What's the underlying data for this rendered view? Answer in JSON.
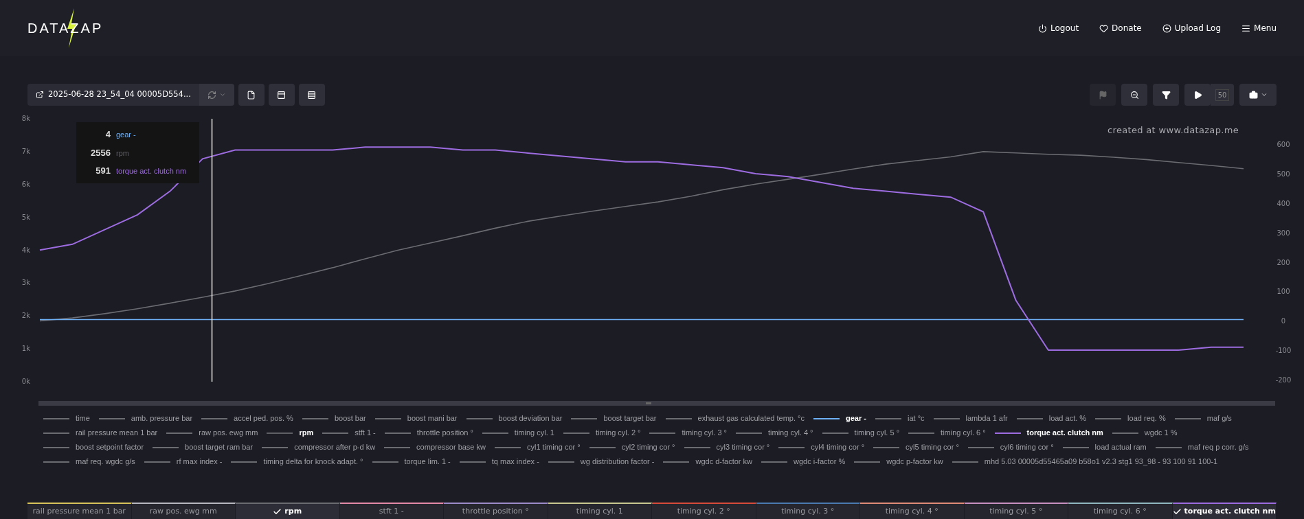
{
  "header": {
    "logo": "DATAZAP",
    "nav": [
      {
        "kind": "power",
        "label": "Logout"
      },
      {
        "kind": "heart",
        "label": "Donate"
      },
      {
        "kind": "plus",
        "label": "Upload Log"
      },
      {
        "kind": "menu",
        "label": "Menu"
      }
    ]
  },
  "toolbar": {
    "file_name": "2025-06-28 23_54_04 00005D554...",
    "left_buttons": [
      {
        "kind": "file"
      },
      {
        "kind": "panel"
      },
      {
        "kind": "rows"
      }
    ],
    "right_buttons": [
      {
        "kind": "flag",
        "disabled": true
      },
      {
        "kind": "zoom",
        "disabled": false
      },
      {
        "kind": "filter",
        "disabled": false
      },
      {
        "kind": "play",
        "disabled": false
      }
    ],
    "speed": "50"
  },
  "chart": {
    "watermark": "created at www.datazap.me",
    "cursor": {
      "level": 0.143
    },
    "tooltip": [
      {
        "value": "4",
        "label": "gear -",
        "color": "#6fb1f7"
      },
      {
        "value": "2556",
        "label": "rpm",
        "color": "#5f5f66"
      },
      {
        "value": "591",
        "label": "torque act. clutch nm",
        "color": "#9d6ce0"
      }
    ],
    "chart_data": {
      "type": "line",
      "yticks": [
        {
          "value": 0,
          "label": "0k"
        },
        {
          "value": 1000,
          "label": "1k"
        },
        {
          "value": 2000,
          "label": "2k"
        },
        {
          "value": 3000,
          "label": "3k"
        },
        {
          "value": 4000,
          "label": "4k"
        },
        {
          "value": 5000,
          "label": "5k"
        },
        {
          "value": 6000,
          "label": "6k"
        },
        {
          "value": 7000,
          "label": "7k"
        },
        {
          "value": 8000,
          "label": "8k"
        }
      ],
      "y2ticks": [
        -200,
        -100,
        0,
        100,
        200,
        300,
        400,
        500,
        600
      ],
      "ylim": [
        0,
        8000
      ],
      "y2lim": [
        -200,
        600
      ],
      "series": [
        {
          "color": "#6b6b72",
          "values": [
            1850,
            1940,
            2070,
            2220,
            2390,
            2570,
            2760,
            2980,
            3220,
            3470,
            3740,
            4000,
            4220,
            4440,
            4670,
            4880,
            5040,
            5190,
            5330,
            5470,
            5640,
            5840,
            6010,
            6160,
            6310,
            6470,
            6620,
            6730,
            6840,
            7000,
            6960,
            6920,
            6890,
            6830,
            6760,
            6670,
            6580,
            6480
          ]
        },
        {
          "axis": "y2",
          "color": "#6fb1f7",
          "values": [
            4,
            4,
            4,
            4,
            4,
            4,
            4,
            4,
            4,
            4,
            4,
            4,
            4,
            4,
            4,
            4,
            4,
            4,
            4,
            4,
            4,
            4,
            4,
            4,
            4,
            4,
            4,
            4,
            4,
            4,
            4,
            4,
            4,
            4,
            4,
            4,
            4,
            4
          ]
        },
        {
          "axis": "y2",
          "color": "#9d6ce0",
          "values": [
            240,
            260,
            310,
            360,
            440,
            550,
            580,
            580,
            580,
            580,
            590,
            590,
            590,
            580,
            580,
            570,
            560,
            550,
            540,
            540,
            530,
            520,
            500,
            490,
            470,
            450,
            440,
            430,
            420,
            370,
            70,
            -100,
            -100,
            -100,
            -100,
            -100,
            -90,
            -90
          ]
        }
      ]
    }
  },
  "legend": [
    {
      "label": "time",
      "selected": false,
      "color": "#6b6b72"
    },
    {
      "label": "amb. pressure bar",
      "selected": false,
      "color": "#6b6b72"
    },
    {
      "label": "accel ped. pos. %",
      "selected": false,
      "color": "#6b6b72"
    },
    {
      "label": "boost bar",
      "selected": false,
      "color": "#6b6b72"
    },
    {
      "label": "boost mani bar",
      "selected": false,
      "color": "#6b6b72"
    },
    {
      "label": "boost deviation bar",
      "selected": false,
      "color": "#6b6b72"
    },
    {
      "label": "boost target bar",
      "selected": false,
      "color": "#6b6b72"
    },
    {
      "label": "exhaust gas calculated temp. °c",
      "selected": false,
      "color": "#6b6b72"
    },
    {
      "label": "gear -",
      "selected": true,
      "color": "#6fb1f7"
    },
    {
      "label": "iat °c",
      "selected": false,
      "color": "#6b6b72"
    },
    {
      "label": "lambda 1 afr",
      "selected": false,
      "color": "#6b6b72"
    },
    {
      "label": "load act. %",
      "selected": false,
      "color": "#6b6b72"
    },
    {
      "label": "load req. %",
      "selected": false,
      "color": "#6b6b72"
    },
    {
      "label": "maf g/s",
      "selected": false,
      "color": "#6b6b72"
    },
    {
      "label": "rail pressure mean 1 bar",
      "selected": false,
      "color": "#6b6b72"
    },
    {
      "label": "raw pos. ewg mm",
      "selected": false,
      "color": "#6b6b72"
    },
    {
      "label": "rpm",
      "selected": true,
      "color": "#5f5f66"
    },
    {
      "label": "stft 1 -",
      "selected": false,
      "color": "#6b6b72"
    },
    {
      "label": "throttle position °",
      "selected": false,
      "color": "#6b6b72"
    },
    {
      "label": "timing cyl. 1",
      "selected": false,
      "color": "#6b6b72"
    },
    {
      "label": "timing cyl. 2 °",
      "selected": false,
      "color": "#6b6b72"
    },
    {
      "label": "timing cyl. 3 °",
      "selected": false,
      "color": "#6b6b72"
    },
    {
      "label": "timing cyl. 4 °",
      "selected": false,
      "color": "#6b6b72"
    },
    {
      "label": "timing cyl. 5 °",
      "selected": false,
      "color": "#6b6b72"
    },
    {
      "label": "timing cyl. 6 °",
      "selected": false,
      "color": "#6b6b72"
    },
    {
      "label": "torque act. clutch nm",
      "selected": true,
      "color": "#9d6ce0"
    },
    {
      "label": "wgdc 1 %",
      "selected": false,
      "color": "#6b6b72"
    },
    {
      "label": "boost setpoint factor",
      "selected": false,
      "color": "#6b6b72"
    },
    {
      "label": "boost target ram bar",
      "selected": false,
      "color": "#6b6b72"
    },
    {
      "label": "compressor after p-d kw",
      "selected": false,
      "color": "#6b6b72"
    },
    {
      "label": "compressor base kw",
      "selected": false,
      "color": "#6b6b72"
    },
    {
      "label": "cyl1 timing cor °",
      "selected": false,
      "color": "#6b6b72"
    },
    {
      "label": "cyl2 timing cor °",
      "selected": false,
      "color": "#6b6b72"
    },
    {
      "label": "cyl3 timing cor °",
      "selected": false,
      "color": "#6b6b72"
    },
    {
      "label": "cyl4 timing cor °",
      "selected": false,
      "color": "#6b6b72"
    },
    {
      "label": "cyl5 timing cor °",
      "selected": false,
      "color": "#6b6b72"
    },
    {
      "label": "cyl6 timing cor °",
      "selected": false,
      "color": "#6b6b72"
    },
    {
      "label": "load actual ram",
      "selected": false,
      "color": "#6b6b72"
    },
    {
      "label": "maf req p corr. g/s",
      "selected": false,
      "color": "#6b6b72"
    },
    {
      "label": "maf req. wgdc g/s",
      "selected": false,
      "color": "#6b6b72"
    },
    {
      "label": "rf max index -",
      "selected": false,
      "color": "#6b6b72"
    },
    {
      "label": "timing delta for knock adapt. °",
      "selected": false,
      "color": "#6b6b72"
    },
    {
      "label": "torque lim. 1 -",
      "selected": false,
      "color": "#6b6b72"
    },
    {
      "label": "tq max index -",
      "selected": false,
      "color": "#6b6b72"
    },
    {
      "label": "wg distribution factor -",
      "selected": false,
      "color": "#6b6b72"
    },
    {
      "label": "wgdc d-factor kw",
      "selected": false,
      "color": "#6b6b72"
    },
    {
      "label": "wgdc i-factor %",
      "selected": false,
      "color": "#6b6b72"
    },
    {
      "label": "wgdc p-factor kw",
      "selected": false,
      "color": "#6b6b72"
    },
    {
      "label": "mhd 5.03 00005d55465a09 b58o1 v2.3 stg1 93_98 - 93 100 91 100-1",
      "selected": false,
      "color": "#6b6b72"
    }
  ],
  "channel_tabs": [
    {
      "label": "rail pressure mean 1 bar",
      "checked": false,
      "color": "#d8c25a"
    },
    {
      "label": "raw pos. ewg mm",
      "checked": false,
      "color": "#b8b8c0"
    },
    {
      "label": "rpm",
      "checked": true,
      "color": "#6b6b72"
    },
    {
      "label": "stft 1 -",
      "checked": false,
      "color": "#e48aa8"
    },
    {
      "label": "throttle position °",
      "checked": false,
      "color": "#9d8ac8"
    },
    {
      "label": "timing cyl. 1",
      "checked": false,
      "color": "#c8c890"
    },
    {
      "label": "timing cyl. 2 °",
      "checked": false,
      "color": "#d84a3a"
    },
    {
      "label": "timing cyl. 3 °",
      "checked": false,
      "color": "#4a7ab0"
    },
    {
      "label": "timing cyl. 4 °",
      "checked": false,
      "color": "#e08a78"
    },
    {
      "label": "timing cyl. 5 °",
      "checked": false,
      "color": "#c890c0"
    },
    {
      "label": "timing cyl. 6 °",
      "checked": false,
      "color": "#90b8c0"
    },
    {
      "label": "torque act. clutch nm",
      "checked": true,
      "color": "#9d6ce0"
    }
  ]
}
